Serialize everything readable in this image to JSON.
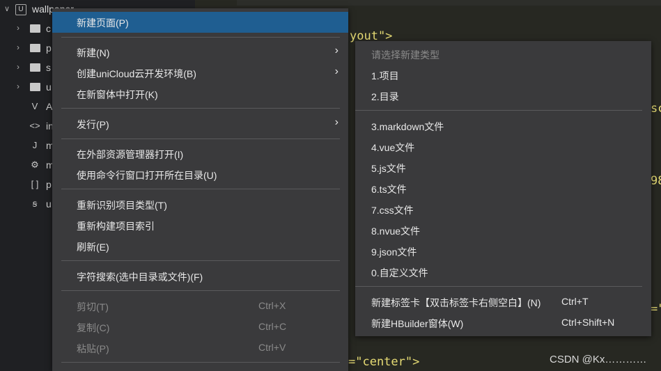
{
  "sidebar": {
    "project_chevron": "∨",
    "project_badge": "U",
    "project_name": "wallpaper",
    "items": [
      {
        "icon": "folder-icon",
        "label": "c"
      },
      {
        "icon": "folder-icon",
        "label": "p"
      },
      {
        "icon": "folder-icon",
        "label": "s"
      },
      {
        "icon": "folder-icon",
        "label": "u"
      },
      {
        "icon": "vue-file-icon",
        "glyph": "V",
        "label": "A"
      },
      {
        "icon": "code-file-icon",
        "glyph": "<>",
        "label": "in"
      },
      {
        "icon": "js-file-icon",
        "glyph": "J",
        "label": "m"
      },
      {
        "icon": "settings-file-icon",
        "glyph": "⚙",
        "label": "m"
      },
      {
        "icon": "json-file-icon",
        "glyph": "[ ]",
        "label": "p"
      },
      {
        "icon": "uni-file-icon",
        "glyph": "ꞩ",
        "label": "u"
      }
    ]
  },
  "editor": {
    "line1_end": "yout\">",
    "line2_frag": "sc",
    "line3_frag": "98",
    "line4_frag": "=\"",
    "line5_text": "=\"center\">"
  },
  "context_menu": {
    "items": [
      {
        "label": "新建页面(P)",
        "highlighted": true
      },
      {
        "label": "新建(N)",
        "submenu": true
      },
      {
        "label": "创建uniCloud云开发环境(B)",
        "submenu": true
      },
      {
        "label": "在新窗体中打开(K)"
      },
      {
        "label": "发行(P)",
        "submenu": true
      },
      {
        "label": "在外部资源管理器打开(I)"
      },
      {
        "label": "使用命令行窗口打开所在目录(U)"
      },
      {
        "label": "重新识别项目类型(T)"
      },
      {
        "label": "重新构建项目索引"
      },
      {
        "label": "刷新(E)"
      },
      {
        "label": "字符搜索(选中目录或文件)(F)"
      },
      {
        "label": "剪切(T)",
        "shortcut": "Ctrl+X",
        "disabled": true
      },
      {
        "label": "复制(C)",
        "shortcut": "Ctrl+C",
        "disabled": true
      },
      {
        "label": "粘贴(P)",
        "shortcut": "Ctrl+V",
        "disabled": true
      }
    ],
    "submenu_arrow": "›"
  },
  "new_submenu": {
    "header": "请选择新建类型",
    "items": [
      {
        "label": "1.项目"
      },
      {
        "label": "2.目录"
      },
      {
        "label": "3.markdown文件"
      },
      {
        "label": "4.vue文件"
      },
      {
        "label": "5.js文件"
      },
      {
        "label": "6.ts文件"
      },
      {
        "label": "7.css文件"
      },
      {
        "label": "8.nvue文件"
      },
      {
        "label": "9.json文件"
      },
      {
        "label": "0.自定义文件"
      },
      {
        "label": "新建标签卡【双击标签卡右侧空白】(N)",
        "shortcut": "Ctrl+T"
      },
      {
        "label": "新建HBuilder窗体(W)",
        "shortcut": "Ctrl+Shift+N"
      }
    ]
  },
  "watermark": "CSDN @Kx…………",
  "colors": {
    "highlight": "#1f5e91",
    "menu_bg": "#3a3a3c",
    "editor_bg": "#272822"
  }
}
